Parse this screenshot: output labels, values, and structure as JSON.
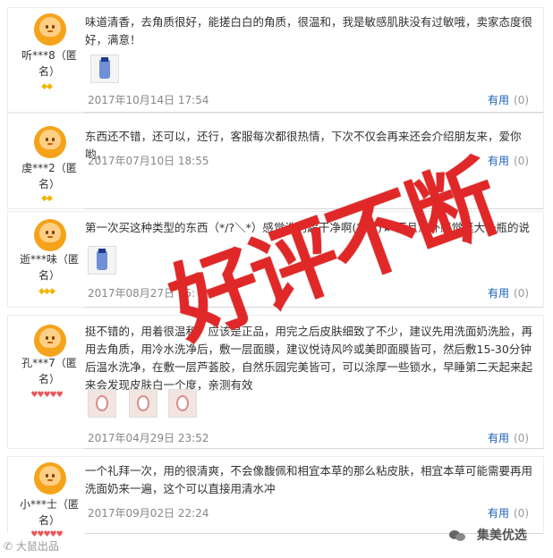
{
  "reviews": [
    {
      "user": "听***8（匿名）",
      "badge": "◆◆",
      "badge_color": "gold",
      "comment": "味道清香，去角质很好，能搓白白的角质，很温和，我是敏感肌肤没有过敏哦，卖家态度很好，满意！",
      "images": [
        "product-photo"
      ],
      "date": "2017年10月14日 17:54",
      "useful_label": "有用",
      "useful_count": "(0)"
    },
    {
      "user": "虔***2（匿名）",
      "badge": "◆◆",
      "badge_color": "gold",
      "comment": "东西还不错，还可以，还行，客服每次都很热情，下次不仅会再来还会介绍朋友来，爱你哟，",
      "images": [],
      "date": "2017年07月10日 18:55",
      "useful_label": "有用",
      "useful_count": "(0)"
    },
    {
      "user": "逝***味（匿名）",
      "badge": "◆◆◆",
      "badge_color": "gold",
      "comment": "第一次买这种类型的东西（*/?＼*）感觉洗的超干净啊(?ω?)★ 而且意外感觉挺大一瓶的说",
      "images": [
        "product-photo"
      ],
      "date": "2017年08月27日 15:",
      "useful_label": "有用",
      "useful_count": "(0)"
    },
    {
      "user": "孔***7（匿名）",
      "badge": "♥♥♥♥♥",
      "badge_color": "red",
      "comment": "挺不错的，用着很温和，应该是正品，用完之后皮肤细致了不少，建议先用洗面奶洗脸，再用去角质，用冷水洗净后，敷一层面膜，建议悦诗风吟或美即面膜皆可，然后敷15-30分钟后温水洗净，在敷一层芦荟胶，自然乐园完美皆可，可以涂厚一些锁水，早睡第二天起来起来会发现皮肤白一个度，亲测有效",
      "images": [
        "face-photo-1",
        "face-photo-2",
        "face-photo-3"
      ],
      "date": "2017年04月29日 23:52",
      "useful_label": "有用",
      "useful_count": "(0)"
    },
    {
      "user": "小***士（匿名）",
      "badge": "♥♥♥♥♥",
      "badge_color": "red",
      "comment": "一个礼拜一次，用的很清爽，不会像馥佩和相宜本草的那么粘皮肤，相宜本草可能需要再用洗面奶来一遍，这个可以直接用清水冲",
      "images": [],
      "date": "2017年09月02日 22:24",
      "useful_label": "有用",
      "useful_count": "(0)"
    }
  ],
  "stamp": "好评不断",
  "watermark_left": "大鼠出品",
  "watermark_right": "集美优选"
}
